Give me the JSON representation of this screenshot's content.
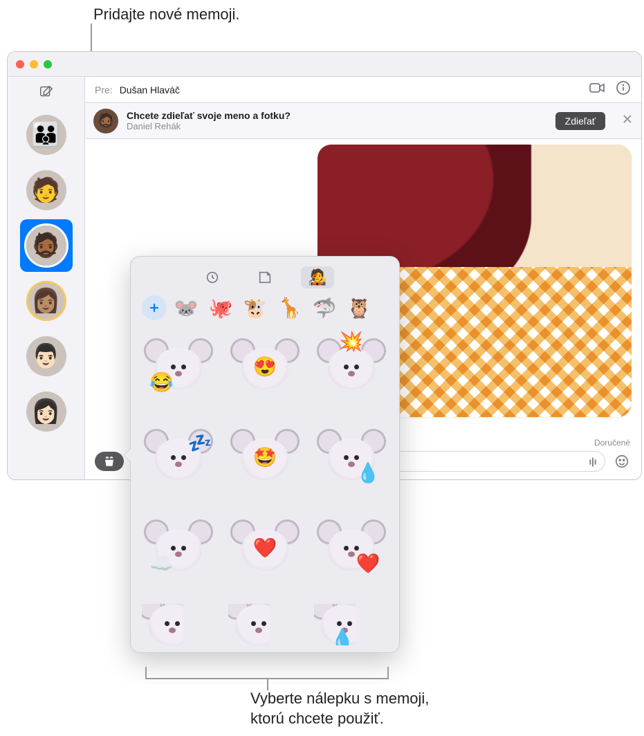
{
  "callouts": {
    "top": "Pridajte nové memoji.",
    "bottom_line1": "Vyberte nálepku s memoji,",
    "bottom_line2": "ktorú chcete použiť."
  },
  "to_bar": {
    "label": "Pre:",
    "recipient": "Dušan Hlaváč"
  },
  "share_banner": {
    "question": "Chcete zdieľať svoje meno a fotku?",
    "subtitle": "Daniel Rehák",
    "button": "Zdieľať"
  },
  "conversation": {
    "delivered": "Doručené"
  },
  "popover": {
    "tabs": [
      "recent",
      "stickers",
      "memoji"
    ],
    "memoji_heads": [
      "🐭",
      "🐙",
      "🐮",
      "🦒",
      "🦈",
      "🦉"
    ],
    "stickers": [
      {
        "name": "mouse-laugh-cry",
        "overlay": "😂",
        "pos": "bl"
      },
      {
        "name": "mouse-heart-eyes",
        "overlay": "😍",
        "pos": "c"
      },
      {
        "name": "mouse-mind-blown",
        "overlay": "💥",
        "pos": "t"
      },
      {
        "name": "mouse-sleep",
        "overlay": "💤",
        "pos": "tr"
      },
      {
        "name": "mouse-starstruck",
        "overlay": "🤩",
        "pos": "c"
      },
      {
        "name": "mouse-tear",
        "overlay": "💧",
        "pos": "br"
      },
      {
        "name": "mouse-cloud",
        "overlay": "☁️",
        "pos": "bl"
      },
      {
        "name": "mouse-hearts",
        "overlay": "❤️",
        "pos": "c"
      },
      {
        "name": "mouse-heart-cheek",
        "overlay": "❤️",
        "pos": "br"
      },
      {
        "name": "mouse-neutral",
        "overlay": "",
        "pos": ""
      },
      {
        "name": "mouse-angry",
        "overlay": "",
        "pos": ""
      },
      {
        "name": "mouse-sweat",
        "overlay": "💧",
        "pos": "br"
      }
    ]
  },
  "sidebar": {
    "threads": [
      {
        "name": "group-thread",
        "selected": false,
        "emoji": "👪"
      },
      {
        "name": "contact-pink",
        "selected": false,
        "emoji": "🧑"
      },
      {
        "name": "contact-memoji",
        "selected": true,
        "emoji": "🧔🏾"
      },
      {
        "name": "contact-ring",
        "selected": false,
        "emoji": "👩🏽"
      },
      {
        "name": "contact-blue",
        "selected": false,
        "emoji": "👨🏻"
      },
      {
        "name": "contact-magenta",
        "selected": false,
        "emoji": "👩🏻"
      }
    ]
  }
}
